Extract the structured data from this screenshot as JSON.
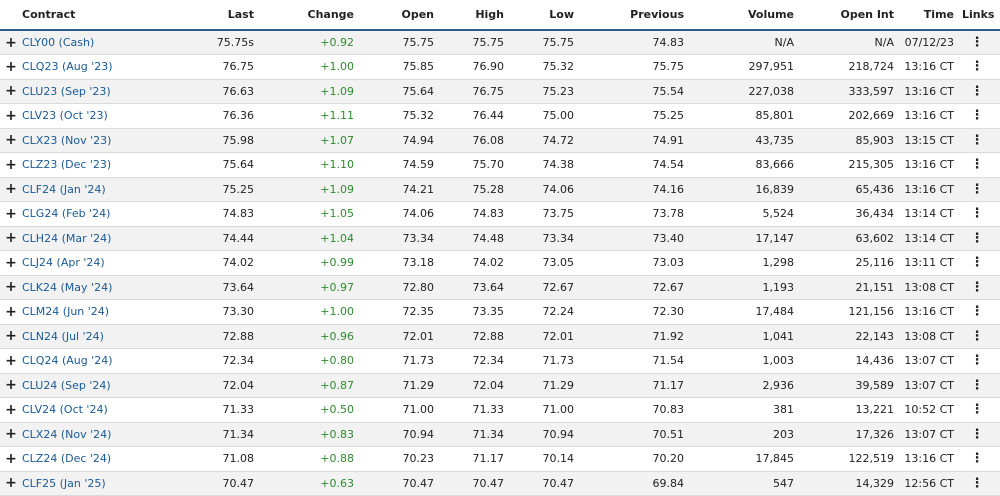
{
  "columns": {
    "contract": "Contract",
    "last": "Last",
    "change": "Change",
    "open": "Open",
    "high": "High",
    "low": "Low",
    "previous": "Previous",
    "volume": "Volume",
    "open_int": "Open Int",
    "time": "Time",
    "links": "Links"
  },
  "expand_icon": "+",
  "links_icon": "⋮",
  "colors": {
    "symbol": "#1a5a96",
    "positive_change": "#2e8b2e",
    "header_border": "#2a5b8f"
  },
  "rows": [
    {
      "contract": "CLY00 (Cash)",
      "last": "75.75s",
      "change": "+0.92",
      "open": "75.75",
      "high": "75.75",
      "low": "75.75",
      "previous": "74.83",
      "volume": "N/A",
      "open_int": "N/A",
      "time": "07/12/23"
    },
    {
      "contract": "CLQ23 (Aug '23)",
      "last": "76.75",
      "change": "+1.00",
      "open": "75.85",
      "high": "76.90",
      "low": "75.32",
      "previous": "75.75",
      "volume": "297,951",
      "open_int": "218,724",
      "time": "13:16 CT"
    },
    {
      "contract": "CLU23 (Sep '23)",
      "last": "76.63",
      "change": "+1.09",
      "open": "75.64",
      "high": "76.75",
      "low": "75.23",
      "previous": "75.54",
      "volume": "227,038",
      "open_int": "333,597",
      "time": "13:16 CT"
    },
    {
      "contract": "CLV23 (Oct '23)",
      "last": "76.36",
      "change": "+1.11",
      "open": "75.32",
      "high": "76.44",
      "low": "75.00",
      "previous": "75.25",
      "volume": "85,801",
      "open_int": "202,669",
      "time": "13:16 CT"
    },
    {
      "contract": "CLX23 (Nov '23)",
      "last": "75.98",
      "change": "+1.07",
      "open": "74.94",
      "high": "76.08",
      "low": "74.72",
      "previous": "74.91",
      "volume": "43,735",
      "open_int": "85,903",
      "time": "13:15 CT"
    },
    {
      "contract": "CLZ23 (Dec '23)",
      "last": "75.64",
      "change": "+1.10",
      "open": "74.59",
      "high": "75.70",
      "low": "74.38",
      "previous": "74.54",
      "volume": "83,666",
      "open_int": "215,305",
      "time": "13:16 CT"
    },
    {
      "contract": "CLF24 (Jan '24)",
      "last": "75.25",
      "change": "+1.09",
      "open": "74.21",
      "high": "75.28",
      "low": "74.06",
      "previous": "74.16",
      "volume": "16,839",
      "open_int": "65,436",
      "time": "13:16 CT"
    },
    {
      "contract": "CLG24 (Feb '24)",
      "last": "74.83",
      "change": "+1.05",
      "open": "74.06",
      "high": "74.83",
      "low": "73.75",
      "previous": "73.78",
      "volume": "5,524",
      "open_int": "36,434",
      "time": "13:14 CT"
    },
    {
      "contract": "CLH24 (Mar '24)",
      "last": "74.44",
      "change": "+1.04",
      "open": "73.34",
      "high": "74.48",
      "low": "73.34",
      "previous": "73.40",
      "volume": "17,147",
      "open_int": "63,602",
      "time": "13:14 CT"
    },
    {
      "contract": "CLJ24 (Apr '24)",
      "last": "74.02",
      "change": "+0.99",
      "open": "73.18",
      "high": "74.02",
      "low": "73.05",
      "previous": "73.03",
      "volume": "1,298",
      "open_int": "25,116",
      "time": "13:11 CT"
    },
    {
      "contract": "CLK24 (May '24)",
      "last": "73.64",
      "change": "+0.97",
      "open": "72.80",
      "high": "73.64",
      "low": "72.67",
      "previous": "72.67",
      "volume": "1,193",
      "open_int": "21,151",
      "time": "13:08 CT"
    },
    {
      "contract": "CLM24 (Jun '24)",
      "last": "73.30",
      "change": "+1.00",
      "open": "72.35",
      "high": "73.35",
      "low": "72.24",
      "previous": "72.30",
      "volume": "17,484",
      "open_int": "121,156",
      "time": "13:16 CT"
    },
    {
      "contract": "CLN24 (Jul '24)",
      "last": "72.88",
      "change": "+0.96",
      "open": "72.01",
      "high": "72.88",
      "low": "72.01",
      "previous": "71.92",
      "volume": "1,041",
      "open_int": "22,143",
      "time": "13:08 CT"
    },
    {
      "contract": "CLQ24 (Aug '24)",
      "last": "72.34",
      "change": "+0.80",
      "open": "71.73",
      "high": "72.34",
      "low": "71.73",
      "previous": "71.54",
      "volume": "1,003",
      "open_int": "14,436",
      "time": "13:07 CT"
    },
    {
      "contract": "CLU24 (Sep '24)",
      "last": "72.04",
      "change": "+0.87",
      "open": "71.29",
      "high": "72.04",
      "low": "71.29",
      "previous": "71.17",
      "volume": "2,936",
      "open_int": "39,589",
      "time": "13:07 CT"
    },
    {
      "contract": "CLV24 (Oct '24)",
      "last": "71.33",
      "change": "+0.50",
      "open": "71.00",
      "high": "71.33",
      "low": "71.00",
      "previous": "70.83",
      "volume": "381",
      "open_int": "13,221",
      "time": "10:52 CT"
    },
    {
      "contract": "CLX24 (Nov '24)",
      "last": "71.34",
      "change": "+0.83",
      "open": "70.94",
      "high": "71.34",
      "low": "70.94",
      "previous": "70.51",
      "volume": "203",
      "open_int": "17,326",
      "time": "13:07 CT"
    },
    {
      "contract": "CLZ24 (Dec '24)",
      "last": "71.08",
      "change": "+0.88",
      "open": "70.23",
      "high": "71.17",
      "low": "70.14",
      "previous": "70.20",
      "volume": "17,845",
      "open_int": "122,519",
      "time": "13:16 CT"
    },
    {
      "contract": "CLF25 (Jan '25)",
      "last": "70.47",
      "change": "+0.63",
      "open": "70.47",
      "high": "70.47",
      "low": "70.47",
      "previous": "69.84",
      "volume": "547",
      "open_int": "14,329",
      "time": "12:56 CT"
    }
  ]
}
